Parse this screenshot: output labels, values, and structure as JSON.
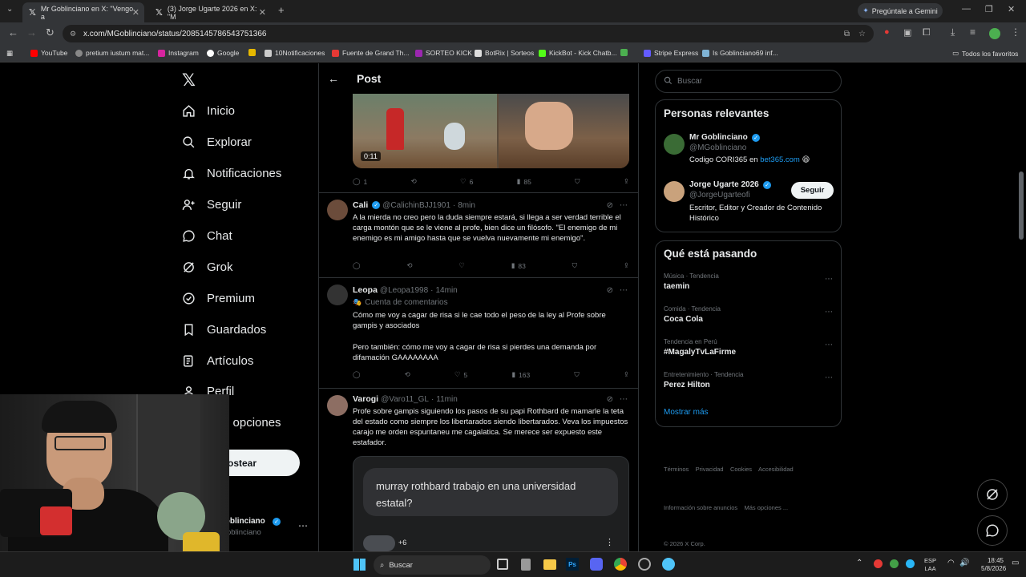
{
  "browser": {
    "tabs": [
      {
        "title": "Mr Goblinciano en X: \"Vengo a",
        "active": true
      },
      {
        "title": "(3) Jorge Ugarte 2026 en X: \"M",
        "active": false
      }
    ],
    "gemini_label": "Pregúntale a Gemini",
    "url": "x.com/MGoblinciano/status/2085145786543751366",
    "bookmarks": [
      "YouTube",
      "pretium iustum mat...",
      "Instagram",
      "Google",
      "10Notificaciones",
      "Fuente de Grand Th...",
      "SORTEO KICK",
      "BotRix | Sorteos",
      "KickBot - Kick Chatb...",
      "Stripe Express",
      "Is Goblinciano69 inf..."
    ],
    "all_favorites": "Todos los favoritos"
  },
  "nav": {
    "items": [
      "Inicio",
      "Explorar",
      "Notificaciones",
      "Seguir",
      "Chat",
      "Grok",
      "Premium",
      "Guardados",
      "Artículos",
      "Perfil",
      "Más opciones"
    ],
    "post_button": "Postear",
    "account_name": "Mr Goblinciano",
    "account_handle": "@MGoblinciano"
  },
  "header": {
    "title": "Post"
  },
  "video": {
    "duration": "0:11",
    "replies": "1",
    "likes": "6",
    "views": "85"
  },
  "tweets": [
    {
      "name": "Cali",
      "handle": "@CalichinBJJ1901",
      "time": "8min",
      "text": "A la mierda no creo pero la duda siempre estará, si llega a ser verdad terrible el carga montón que se le viene al profe, bien dice un filósofo. \"El enemigo de mi enemigo es mi amigo hasta que se vuelva nuevamente mi enemigo\".",
      "views": "83"
    },
    {
      "name": "Leopa",
      "handle": "@Leopa1998",
      "time": "14min",
      "badge": "Cuenta de comentarios",
      "text1": "Cómo me voy a cagar de risa si le cae todo el peso de la ley al Profe sobre gampis y asociados",
      "text2": "Pero también: cómo me voy a cagar de risa si pierdes una demanda por difamación GAAAAAAAA",
      "likes": "5",
      "views": "163"
    },
    {
      "name": "Varogi",
      "handle": "@Varo11_GL",
      "time": "11min",
      "text": "Profe sobre gampis siguiendo los pasos de su papi Rothbard de mamarle la teta del estado como siempre los libertarados siendo libertarados. Veva los impuestos carajo me orden espuntaneu me cagalatica. Se merece ser expuesto este estafador.",
      "quote": "murray rothbard trabajo en una universidad estatal?",
      "quote_count": "+6"
    }
  ],
  "search": {
    "placeholder": "Buscar"
  },
  "relevant": {
    "title": "Personas relevantes",
    "people": [
      {
        "name": "Mr Goblinciano",
        "handle": "@MGoblinciano",
        "bio_prefix": "Codigo CORI365 en ",
        "bio_link": "bet365.com",
        "bio_emoji": "😆"
      },
      {
        "name": "Jorge Ugarte 2026",
        "handle": "@JorgeUgarteofi",
        "bio": "Escritor, Editor y Creador de Contenido Histórico",
        "follow": "Seguir"
      }
    ]
  },
  "trending": {
    "title": "Qué está pasando",
    "items": [
      {
        "category": "Música · Tendencia",
        "name": "taemin"
      },
      {
        "category": "Comida · Tendencia",
        "name": "Coca Cola"
      },
      {
        "category": "Tendencia en Perú",
        "name": "#MagalyTvLaFirme"
      },
      {
        "category": "Entretenimiento · Tendencia",
        "name": "Perez Hilton"
      }
    ],
    "show_more": "Mostrar más"
  },
  "footer": {
    "links1": "Términos    Privacidad    Cookies    Accesibilidad",
    "links2": "Información sobre anuncios    Más opciones ...",
    "copyright": "© 2026 X Corp."
  },
  "taskbar": {
    "search": "Buscar",
    "lang": "ESP",
    "lang2": "LAA",
    "time": "18:45",
    "date": "5/8/2026"
  },
  "colors": {
    "accent": "#1d9bf0",
    "background": "#000000",
    "border": "#2f3336"
  }
}
